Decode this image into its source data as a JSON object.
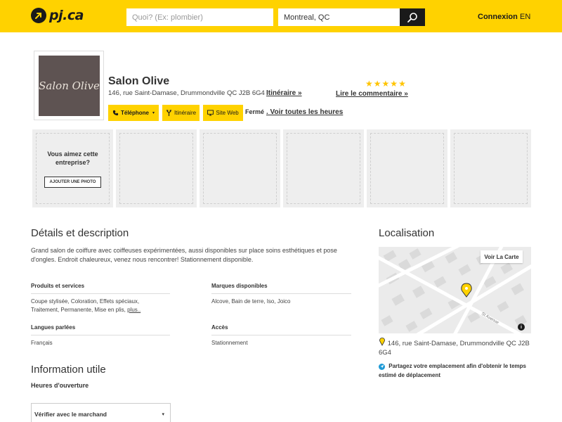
{
  "header": {
    "logo_text": "pj.ca",
    "search_what_placeholder": "Quoi? (Ex: plombier)",
    "search_where_value": "Montreal, QC",
    "login_label": "Connexion",
    "lang_label": "EN"
  },
  "business": {
    "logo_text": "Salon Olive",
    "name": "Salon Olive",
    "address": "146, rue Saint-Damase, Drummondville QC J2B 6G4",
    "itinerary_link": "Itinéraire »",
    "rating_stars": 5,
    "review_link": "Lire le commentaire »",
    "phone_button": "Téléphone",
    "itinerary_button": "Itinéraire",
    "website_button": "Site Web",
    "status": "Fermé",
    "hours_link": ". Voir toutes les heures"
  },
  "photos": {
    "question": "Vous aimez cette entreprise?",
    "add_photo_button": "AJOUTER UNE PHOTO"
  },
  "details": {
    "title": "Détails et description",
    "description": "Grand salon de coiffure avec coiffeuses expérimentées, aussi disponibles sur place soins esthétiques et pose d'ongles. Endroit chaleureux, venez nous rencontrer! Stationnement disponible.",
    "products_title": "Produits et services",
    "products_value": "Coupe stylisée, Coloration, Effets spéciaux, Traitement, Permanente, Mise en plis,",
    "products_more": "plus..",
    "brands_title": "Marques disponibles",
    "brands_value": "Alcove, Bain de terre, Iso, Joico",
    "languages_title": "Langues parlées",
    "languages_value": "Français",
    "access_title": "Accès",
    "access_value": "Stationnement"
  },
  "info": {
    "title": "Information utile",
    "hours_title": "Heures d'ouverture",
    "verify_select": "Vérifier avec le marchand"
  },
  "location": {
    "title": "Localisation",
    "map_button": "Voir La Carte",
    "street_label": "St Avenue",
    "info_icon": "i",
    "address": "146, rue Saint-Damase, Drummondville QC J2B 6G4",
    "share_text": "Partagez votre emplacement afin d'obtenir le temps estimé de déplacement"
  },
  "colors": {
    "brand_yellow": "#ffd200",
    "dark": "#1a1a1a",
    "star": "#ffc400",
    "share_blue": "#1e9ad6"
  }
}
